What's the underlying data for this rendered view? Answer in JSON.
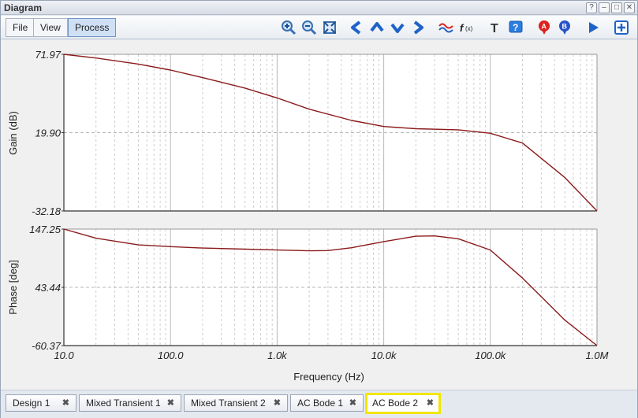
{
  "window": {
    "title": "Diagram",
    "controls": [
      "?",
      "–",
      "□",
      "✕"
    ]
  },
  "menu": {
    "items": [
      "File",
      "View",
      "Process"
    ],
    "active": "Process"
  },
  "toolbar": {
    "icons": [
      "zoom-in-icon",
      "zoom-out-icon",
      "zoom-fit-icon",
      "arrow-left-icon",
      "arrow-up-icon",
      "arrow-down-icon",
      "arrow-right-icon",
      "waveform-icon",
      "function-icon",
      "text-icon",
      "help-icon",
      "marker-a-icon",
      "marker-b-icon",
      "play-icon",
      "add-icon"
    ]
  },
  "chart_data": [
    {
      "type": "line",
      "panel": "gain",
      "xlabel": "Frequency (Hz)",
      "ylabel": "Gain (dB)",
      "x_scale": "log",
      "xlim": [
        10,
        1000000
      ],
      "ylim": [
        -32.18,
        71.97
      ],
      "y_ticks": [
        "71.97",
        "19.90",
        "-32.18"
      ],
      "grid": true,
      "color": "#8b1a1a",
      "x": [
        10,
        20,
        50,
        100,
        200,
        500,
        1000,
        2000,
        5000,
        10000,
        20000,
        50000,
        100000,
        200000,
        500000,
        1000000
      ],
      "y": [
        71.97,
        69.5,
        65.5,
        61.5,
        56.5,
        49.5,
        43.0,
        35.5,
        28.0,
        24.0,
        22.5,
        21.8,
        19.5,
        13.0,
        -10.0,
        -32.18
      ]
    },
    {
      "type": "line",
      "panel": "phase",
      "xlabel": "Frequency (Hz)",
      "ylabel": "Phase [deg]",
      "x_scale": "log",
      "xlim": [
        10,
        1000000
      ],
      "ylim": [
        -60.37,
        147.25
      ],
      "y_ticks": [
        "147.25",
        "43.44",
        "-60.37"
      ],
      "x_ticks": [
        "10.0",
        "100.0",
        "1.0k",
        "10.0k",
        "100.0k",
        "1.0M"
      ],
      "grid": true,
      "color": "#8b1a1a",
      "x": [
        10,
        20,
        50,
        100,
        200,
        500,
        1000,
        2000,
        3000,
        5000,
        10000,
        20000,
        30000,
        50000,
        100000,
        200000,
        500000,
        1000000
      ],
      "y": [
        147.25,
        131.0,
        119.0,
        116.0,
        113.5,
        111.5,
        110.0,
        108.5,
        109.0,
        114.0,
        125.0,
        134.5,
        135.0,
        130.0,
        110.0,
        60.0,
        -15.0,
        -60.37
      ]
    }
  ],
  "tabs": [
    {
      "label": "Design 1"
    },
    {
      "label": "Mixed Transient 1"
    },
    {
      "label": "Mixed Transient 2"
    },
    {
      "label": "AC Bode 1"
    },
    {
      "label": "AC Bode 2",
      "active": true
    }
  ]
}
